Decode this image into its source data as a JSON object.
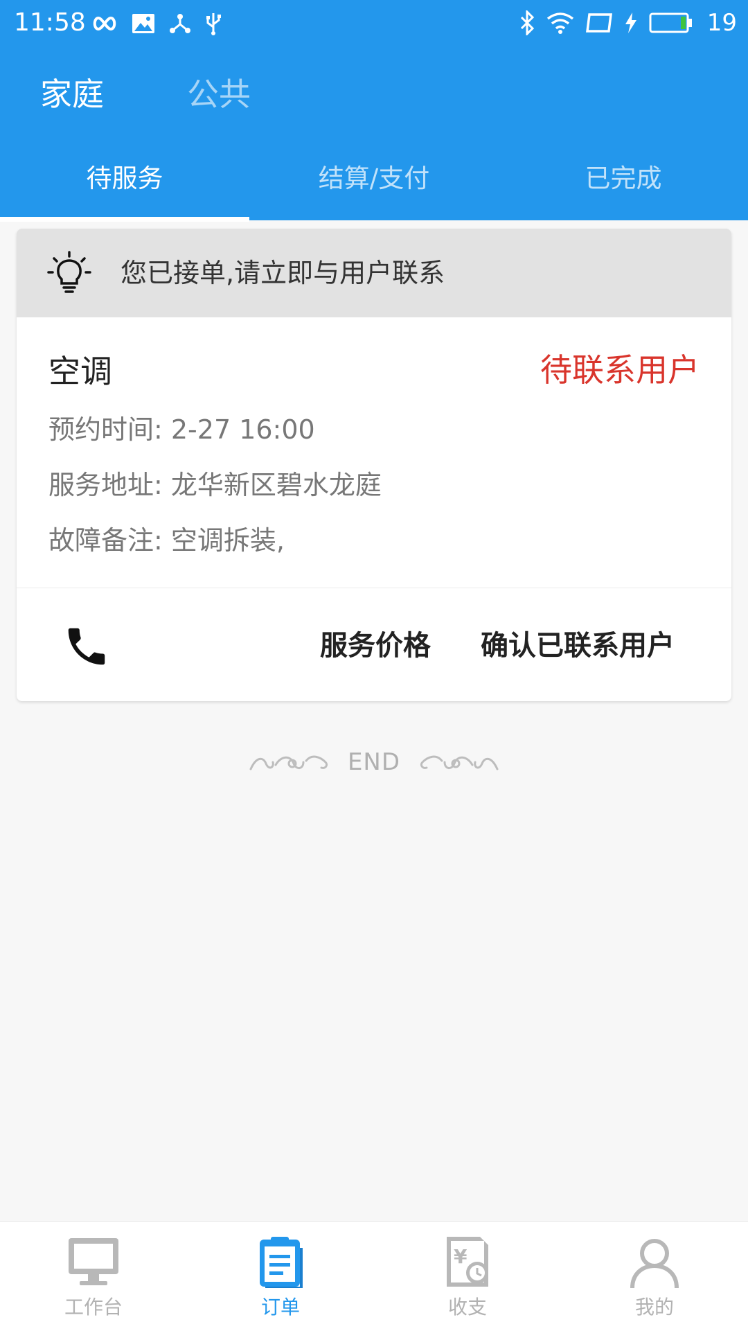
{
  "status_bar": {
    "time": "11:58",
    "battery_level": "19",
    "icons_left": [
      "infinity-icon",
      "image-icon",
      "share-hub-icon",
      "usb-icon"
    ],
    "icons_right": [
      "bluetooth-icon",
      "wifi-icon",
      "nfc-card-icon",
      "charging-icon",
      "battery-icon"
    ]
  },
  "scope_tabs": [
    {
      "label": "家庭",
      "active": true
    },
    {
      "label": "公共",
      "active": false
    }
  ],
  "status_tabs": [
    {
      "label": "待服务",
      "active": true
    },
    {
      "label": "结算/支付",
      "active": false
    },
    {
      "label": "已完成",
      "active": false
    }
  ],
  "order": {
    "notice": "您已接单,请立即与用户联系",
    "service_name": "空调",
    "status": "待联系用户",
    "details": [
      "预约时间: 2-27 16:00",
      "服务地址: 龙华新区碧水龙庭",
      "故障备注: 空调拆装,"
    ],
    "actions": {
      "price_label": "服务价格",
      "confirm_label": "确认已联系用户"
    }
  },
  "end_label": "END",
  "bottom_nav": [
    {
      "label": "工作台",
      "icon": "monitor-icon",
      "active": false
    },
    {
      "label": "订单",
      "icon": "clipboard-icon",
      "active": true
    },
    {
      "label": "收支",
      "icon": "finance-icon",
      "active": false
    },
    {
      "label": "我的",
      "icon": "user-icon",
      "active": false
    }
  ],
  "colors": {
    "primary": "#2397ec",
    "status_red": "#d9352c",
    "background": "#f7f7f7"
  }
}
